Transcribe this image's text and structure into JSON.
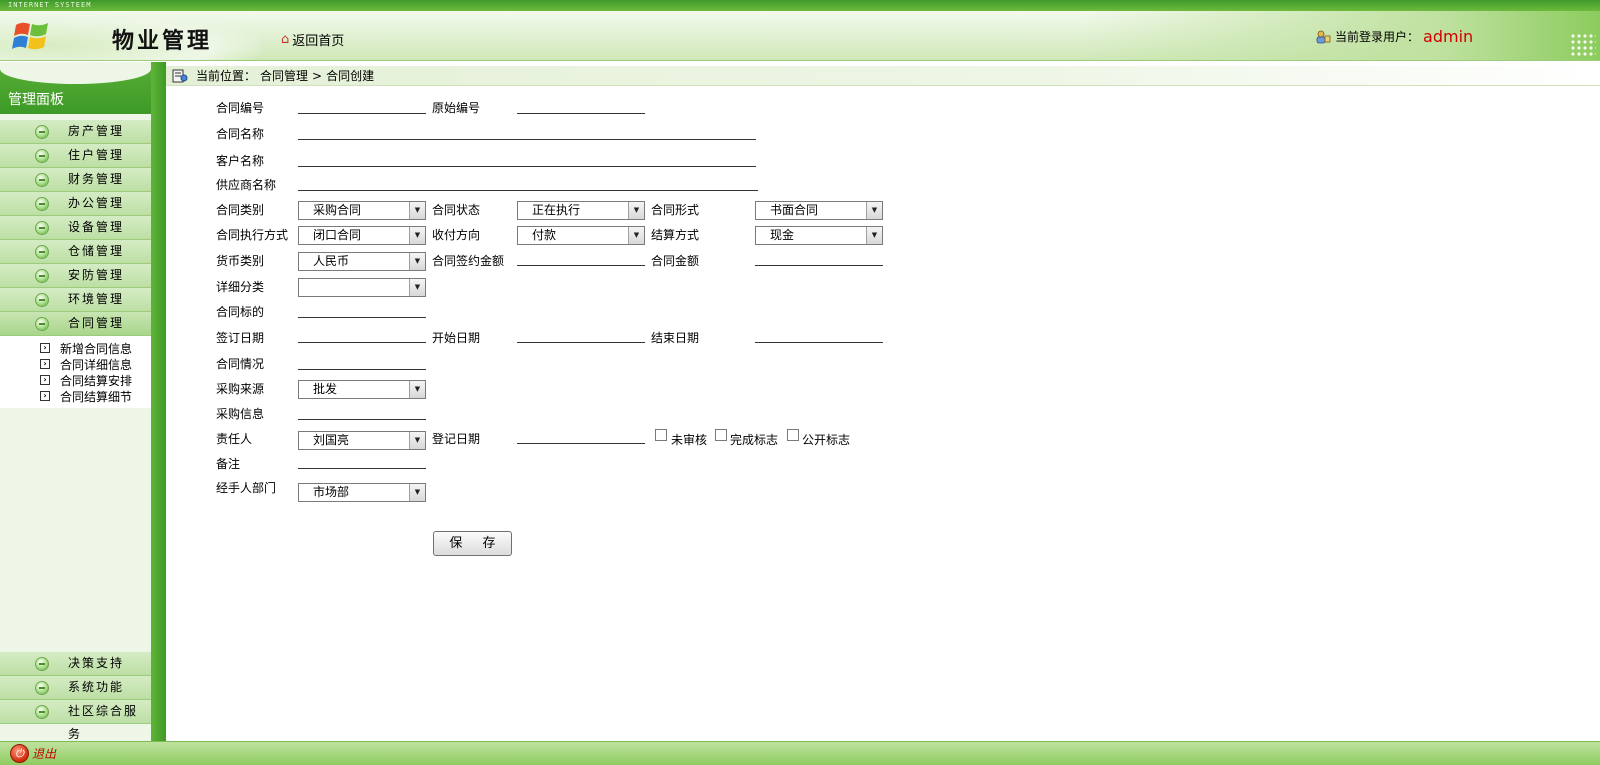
{
  "top_strip": "INTERNET SYSTEEM",
  "header": {
    "title": "物业管理",
    "home_label": "返回首页",
    "user_prefix": "当前登录用户：",
    "user_name": "admin"
  },
  "sidebar": {
    "panel_title": "管理面板",
    "menu": [
      {
        "label": "房产管理"
      },
      {
        "label": "住户管理"
      },
      {
        "label": "财务管理"
      },
      {
        "label": "办公管理"
      },
      {
        "label": "设备管理"
      },
      {
        "label": "仓储管理"
      },
      {
        "label": "安防管理"
      },
      {
        "label": "环境管理"
      },
      {
        "label": "合同管理"
      }
    ],
    "submenu": [
      {
        "label": "新增合同信息"
      },
      {
        "label": "合同详细信息"
      },
      {
        "label": "合同结算安排"
      },
      {
        "label": "合同结算细节"
      }
    ],
    "bottom_menu": [
      {
        "label": "决策支持"
      },
      {
        "label": "系统功能"
      },
      {
        "label": "社区综合服务"
      }
    ]
  },
  "breadcrumb": {
    "prefix": "当前位置：",
    "level1": "合同管理",
    "separator": ">",
    "level2": "合同创建"
  },
  "form": {
    "contract_no": {
      "label": "合同编号",
      "value": ""
    },
    "original_no": {
      "label": "原始编号",
      "value": ""
    },
    "contract_name": {
      "label": "合同名称",
      "value": ""
    },
    "customer_name": {
      "label": "客户名称",
      "value": ""
    },
    "supplier_name": {
      "label": "供应商名称",
      "value": ""
    },
    "contract_type": {
      "label": "合同类别",
      "value": "采购合同"
    },
    "contract_status": {
      "label": "合同状态",
      "value": "正在执行"
    },
    "contract_form": {
      "label": "合同形式",
      "value": "书面合同"
    },
    "execution_mode": {
      "label": "合同执行方式",
      "value": "闭口合同"
    },
    "payment_direction": {
      "label": "收付方向",
      "value": "付款"
    },
    "settlement_method": {
      "label": "结算方式",
      "value": "现金"
    },
    "currency": {
      "label": "货币类别",
      "value": "人民币"
    },
    "signed_amount": {
      "label": "合同签约金额",
      "value": ""
    },
    "contract_amount": {
      "label": "合同金额",
      "value": ""
    },
    "detail_category": {
      "label": "详细分类",
      "value": ""
    },
    "contract_subject": {
      "label": "合同标的",
      "value": ""
    },
    "sign_date": {
      "label": "签订日期",
      "value": ""
    },
    "start_date": {
      "label": "开始日期",
      "value": ""
    },
    "end_date": {
      "label": "结束日期",
      "value": ""
    },
    "contract_situation": {
      "label": "合同情况",
      "value": ""
    },
    "purchase_source": {
      "label": "采购来源",
      "value": "批发"
    },
    "purchase_info": {
      "label": "采购信息",
      "value": ""
    },
    "responsible": {
      "label": "责任人",
      "value": "刘国亮"
    },
    "register_date": {
      "label": "登记日期",
      "value": ""
    },
    "unreviewed": {
      "label": "未审核",
      "checked": false
    },
    "completed": {
      "label": "完成标志",
      "checked": false
    },
    "public_flag": {
      "label": "公开标志",
      "checked": false
    },
    "remarks": {
      "label": "备注",
      "value": ""
    },
    "handler_dept": {
      "label": "经手人部门",
      "value": "市场部"
    }
  },
  "actions": {
    "save_label": "保 存"
  },
  "footer": {
    "logout_label": "退出"
  }
}
